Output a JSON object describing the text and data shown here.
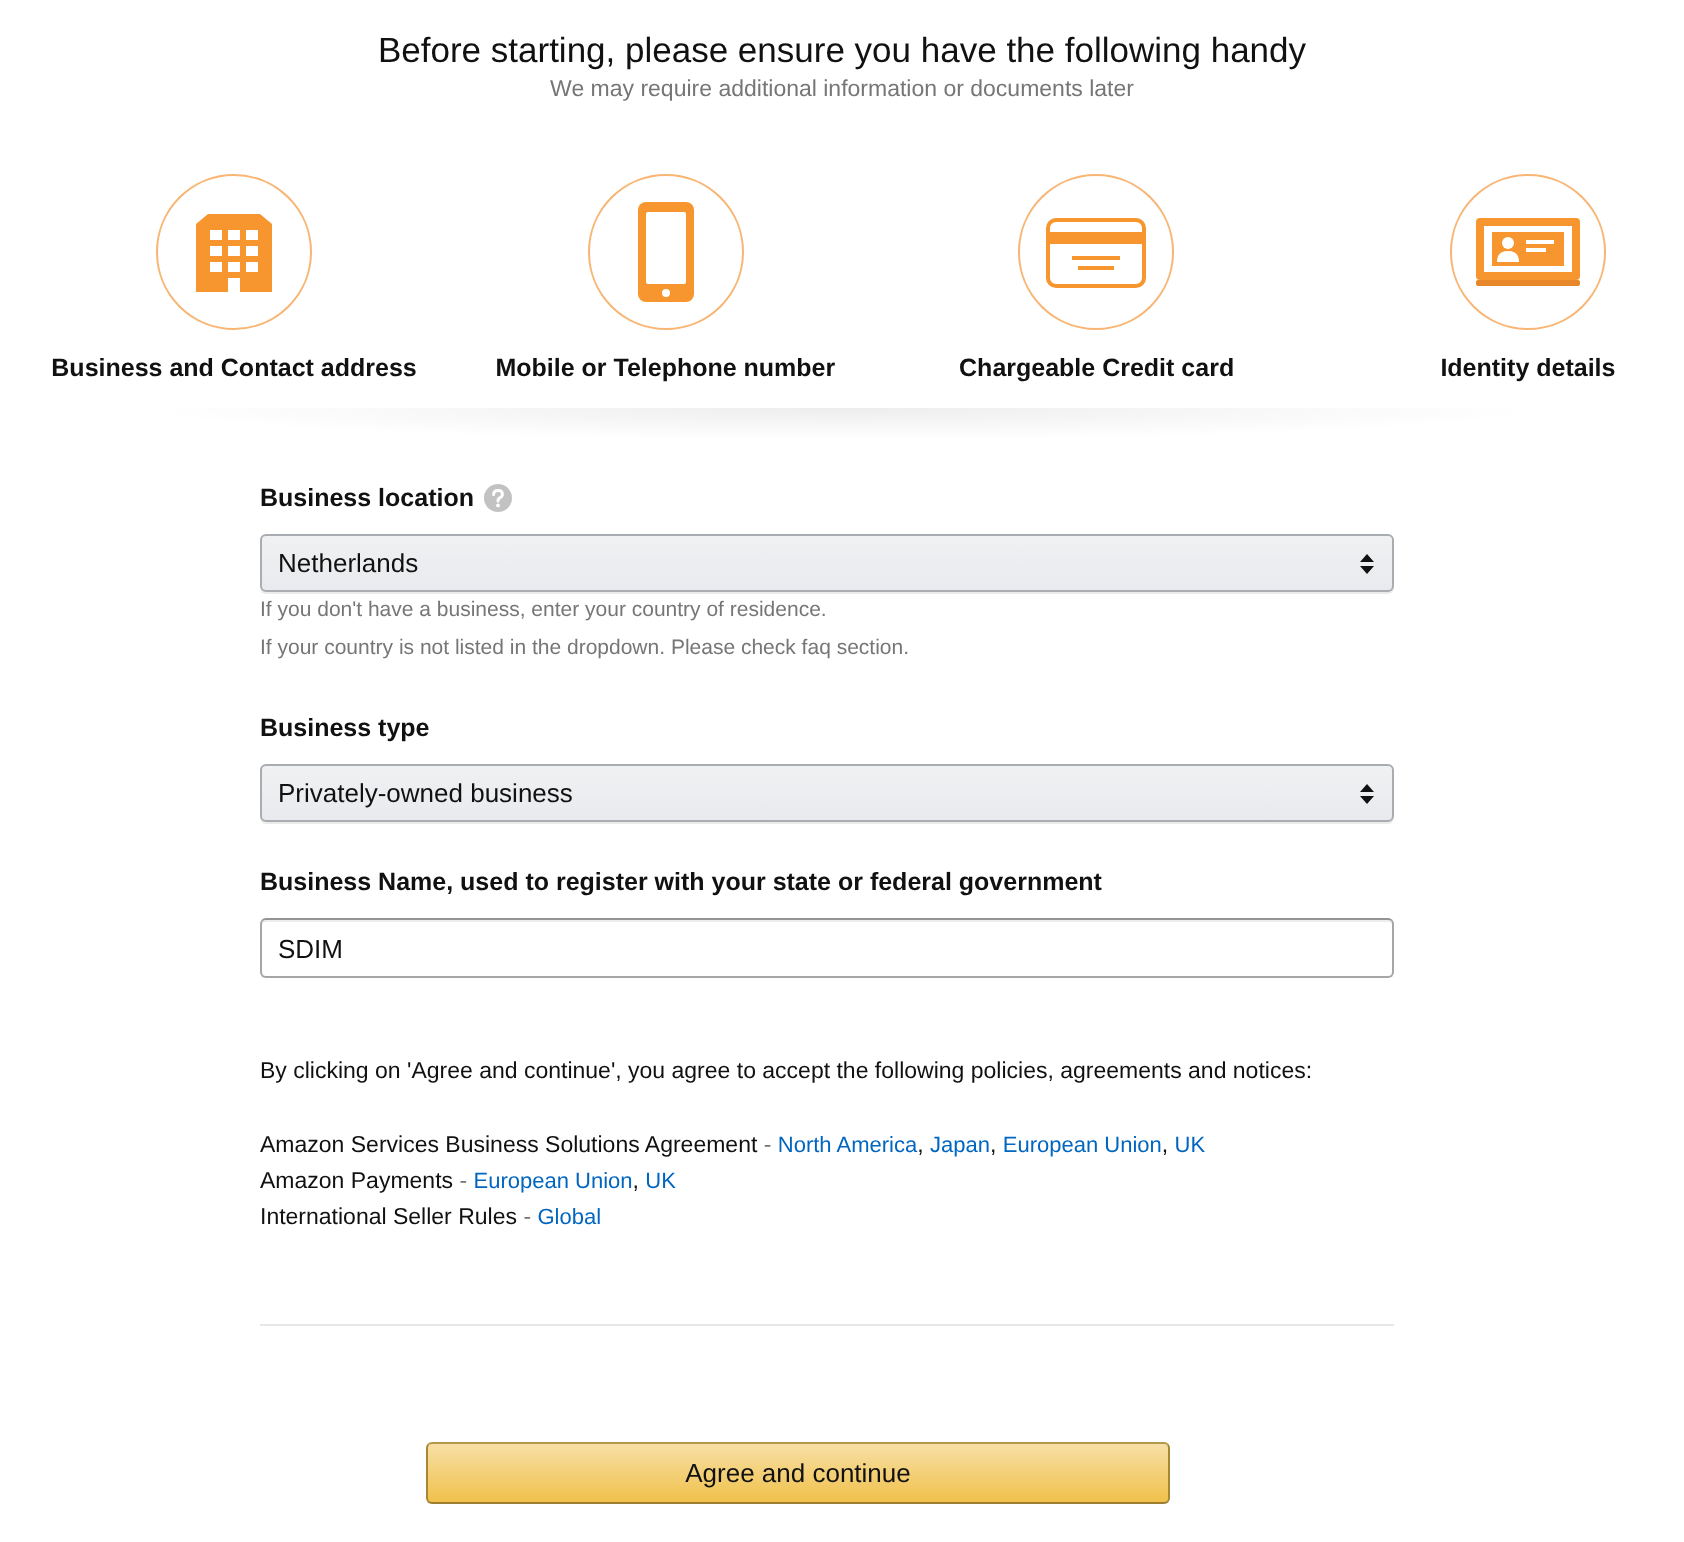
{
  "header": {
    "title": "Before starting, please ensure you have the following handy",
    "subtitle": "We may require additional information or documents later"
  },
  "requirements": [
    {
      "kind": "building",
      "label": "Business and Contact address"
    },
    {
      "kind": "phone",
      "label": "Mobile or Telephone number"
    },
    {
      "kind": "card",
      "label": "Chargeable Credit card"
    },
    {
      "kind": "id",
      "label": "Identity details"
    }
  ],
  "fields": [
    {
      "kind": "select",
      "label": "Business location",
      "help": true,
      "value": "Netherlands",
      "hints": [
        "If you don't have a business, enter your country of residence.",
        "If your country is not listed in the dropdown. Please check faq section."
      ]
    },
    {
      "kind": "select",
      "label": "Business type",
      "help": false,
      "value": "Privately-owned business"
    },
    {
      "kind": "text",
      "label": "Business Name, used to register with your state or federal government",
      "help": false,
      "value": "SDIM"
    }
  ],
  "agreements": {
    "intro": "By clicking on 'Agree and continue', you agree to accept the following policies, agreements and notices:",
    "policies": [
      {
        "name": "Amazon Services Business Solutions Agreement",
        "separator": "-",
        "links": [
          {
            "label": "North America",
            "after": ","
          },
          {
            "label": "Japan",
            "after": ","
          },
          {
            "label": "European Union",
            "after": ","
          },
          {
            "label": "UK"
          }
        ]
      },
      {
        "name": "Amazon Payments",
        "separator": "-",
        "links": [
          {
            "label": "European Union",
            "after": ","
          },
          {
            "label": "UK"
          }
        ]
      },
      {
        "name": "International Seller Rules",
        "separator": "-",
        "links": [
          {
            "label": "Global"
          }
        ]
      }
    ]
  },
  "submit": {
    "label": "Agree and continue"
  }
}
